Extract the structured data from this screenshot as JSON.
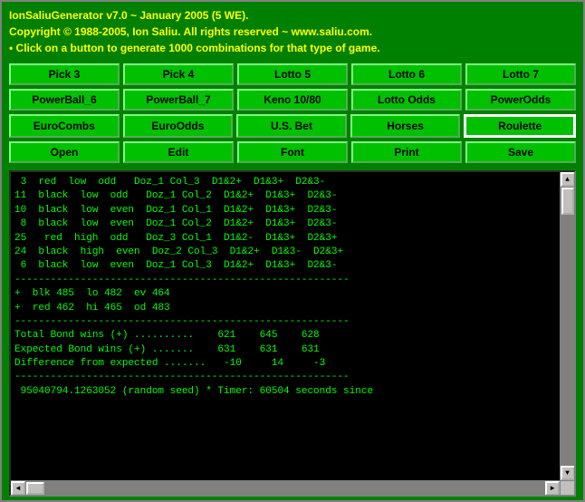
{
  "title": {
    "line1": "IonSaliuGenerator v7.0 ~ January 2005 (5 WE).",
    "line2": "Copyright © 1988-2005, Ion Saliu. All rights reserved ~ www.saliu.com.",
    "line3": "• Click on a button to generate 1000 combinations for that type of game."
  },
  "buttons": {
    "row1": [
      {
        "label": "Pick 3",
        "name": "pick3"
      },
      {
        "label": "Pick 4",
        "name": "pick4"
      },
      {
        "label": "Lotto 5",
        "name": "lotto5"
      },
      {
        "label": "Lotto 6",
        "name": "lotto6"
      },
      {
        "label": "Lotto 7",
        "name": "lotto7"
      }
    ],
    "row2": [
      {
        "label": "PowerBall_6",
        "name": "powerball6"
      },
      {
        "label": "PowerBall_7",
        "name": "powerball7"
      },
      {
        "label": "Keno 10/80",
        "name": "keno"
      },
      {
        "label": "Lotto Odds",
        "name": "lotto-odds"
      },
      {
        "label": "PowerOdds",
        "name": "powerodds"
      }
    ],
    "row3": [
      {
        "label": "EuroCombs",
        "name": "eurocombs"
      },
      {
        "label": "EuroOdds",
        "name": "euroodds"
      },
      {
        "label": "U.S. Bet",
        "name": "usbet"
      },
      {
        "label": "Horses",
        "name": "horses"
      },
      {
        "label": "Roulette",
        "name": "roulette",
        "active": true
      }
    ],
    "row4": [
      {
        "label": "Open",
        "name": "open"
      },
      {
        "label": "Edit",
        "name": "edit"
      },
      {
        "label": "Font",
        "name": "font"
      },
      {
        "label": "Print",
        "name": "print"
      },
      {
        "label": "Save",
        "name": "save"
      }
    ]
  },
  "output": {
    "text": " 3  red  low  odd   Doz_1 Col_3  D1&2+  D1&3+  D2&3-\n11  black  low  odd   Doz_1 Col_2  D1&2+  D1&3+  D2&3-\n10  black  low  even  Doz_1 Col_1  D1&2+  D1&3+  D2&3-\n 8  black  low  even  Doz_1 Col_2  D1&2+  D1&3+  D2&3-\n25   red  high  odd   Doz_3 Col_1  D1&2-  D1&3+  D2&3+\n24  black  high  even  Doz_2 Col_3  D1&2+  D1&3-  D2&3+\n 6  black  low  even  Doz_1 Col_3  D1&2+  D1&3+  D2&3-\n--------------------------------------------------------\n+  blk 485  lo 482  ev 464\n+  red 462  hi 465  od 483\n--------------------------------------------------------\nTotal Bond wins (+) ..........    621    645    628\nExpected Bond wins (+) .......    631    631    631\nDifference from expected .......   -10     14     -3\n--------------------------------------------------------\n 95040794.1263052 (random seed) * Timer: 60504 seconds since"
  }
}
